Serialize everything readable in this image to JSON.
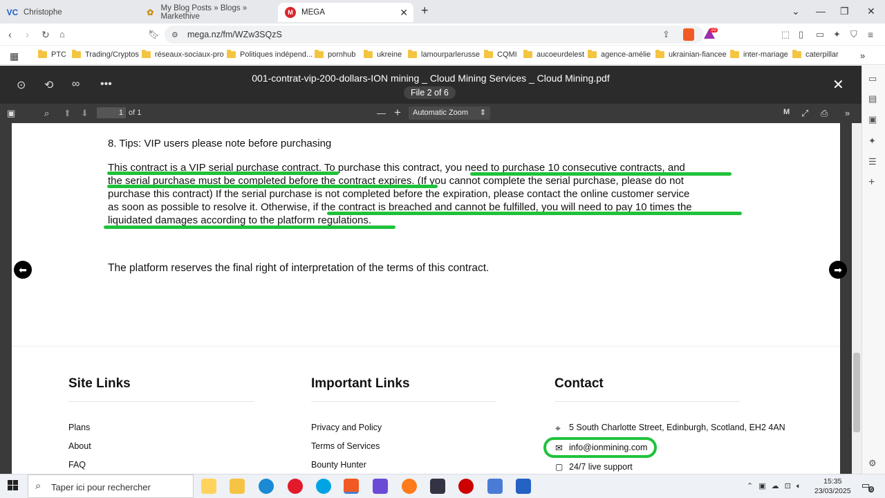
{
  "browser": {
    "tabs": [
      {
        "label": "Christophe",
        "icon": "VC"
      },
      {
        "label": "My Blog Posts » Blogs » Markethive"
      },
      {
        "label": "MEGA",
        "icon": "M"
      }
    ],
    "url": "mega.nz/fm/WZw3SQzS",
    "brave_badge": "10",
    "bookmarks": [
      "PTC",
      "Trading/Cryptos",
      "réseaux-sociaux-pro",
      "Politiques indépend...",
      "pornhub",
      "ukreine",
      "lamourparlerusse",
      "CQMI",
      "aucoeurdelest",
      "agence-amélie",
      "ukrainian-fiancee",
      "inter-mariage",
      "caterpillar"
    ]
  },
  "viewer": {
    "filename": "001-contrat-vip-200-dollars-ION mining _ Cloud Mining Services _ Cloud Mining.pdf",
    "file_counter": "File 2 of 6",
    "page": "1",
    "page_total": "of 1",
    "zoom": "Automatic Zoom"
  },
  "pdf": {
    "heading": "8. Tips: VIP users please note before purchasing",
    "lines": [
      "This contract is a VIP serial purchase contract. To purchase this contract, you need to purchase 10 consecutive contracts, and",
      "the serial purchase must be completed before the contract expires. (If you cannot complete the serial purchase, please do not",
      "purchase this contract) If the serial purchase is not completed before the expiration, please contact the online customer service",
      "as soon as possible to resolve it. Otherwise, if the contract is breached and cannot be fulfilled, you will need to pay 10 times the",
      "liquidated damages according to the platform regulations."
    ],
    "final": "The platform reserves the final right of interpretation of the terms of this contract."
  },
  "footer": {
    "site_links": {
      "title": "Site Links",
      "items": [
        "Plans",
        "About",
        "FAQ"
      ]
    },
    "important_links": {
      "title": "Important Links",
      "items": [
        "Privacy and Policy",
        "Terms of Services",
        "Bounty Hunter"
      ]
    },
    "contact": {
      "title": "Contact",
      "address": "5 South Charlotte Street, Edinburgh, Scotland, EH2 4AN",
      "email": "info@ionmining.com",
      "support": "24/7 live support"
    }
  },
  "taskbar": {
    "search_placeholder": "Taper ici pour rechercher",
    "time": "15:35",
    "date": "23/03/2025",
    "notif": "6"
  },
  "colors": {
    "highlight": "#1fc23b",
    "mega": "#d9272e"
  }
}
